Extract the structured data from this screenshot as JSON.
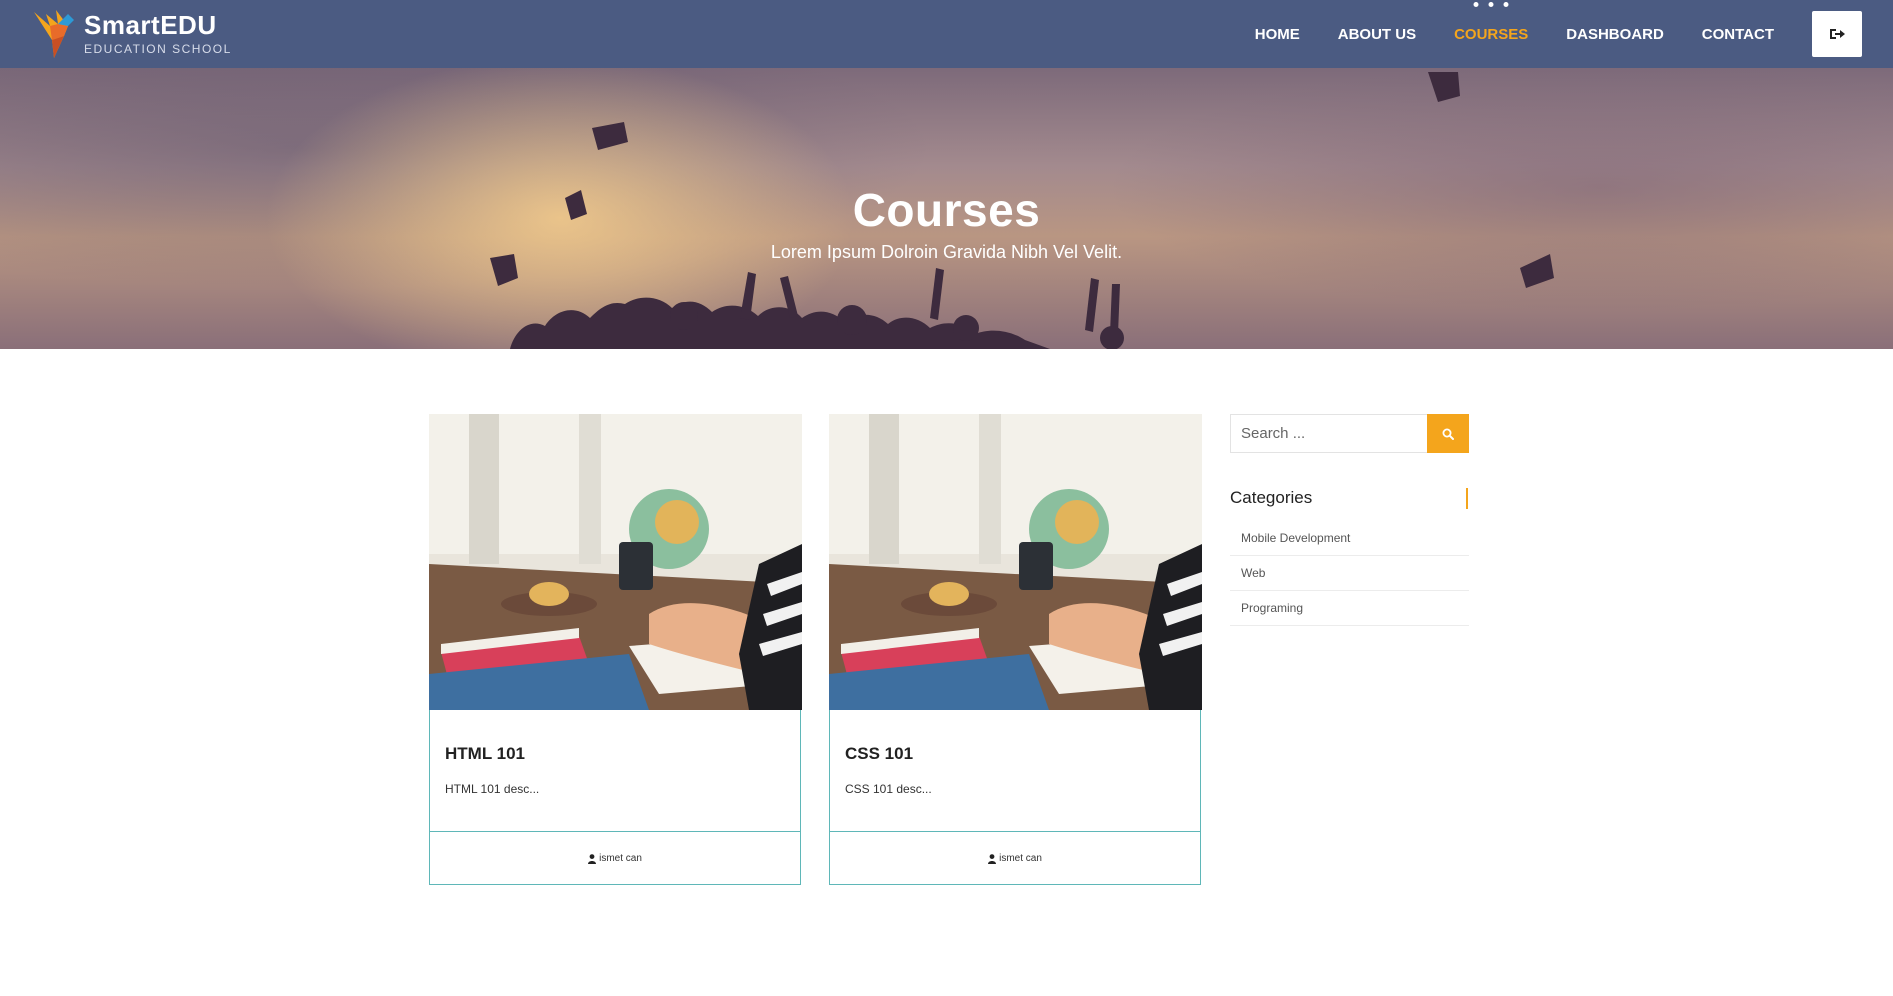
{
  "brand": {
    "name": "SmartEDU",
    "tagline": "EDUCATION SCHOOL"
  },
  "nav": {
    "items": [
      {
        "label": "HOME",
        "active": false
      },
      {
        "label": "ABOUT US",
        "active": false
      },
      {
        "label": "COURSES",
        "active": true
      },
      {
        "label": "DASHBOARD",
        "active": false
      },
      {
        "label": "CONTACT",
        "active": false
      }
    ],
    "logout_icon": "sign-out-icon"
  },
  "hero": {
    "title": "Courses",
    "subtitle": "Lorem Ipsum Dolroin Gravida Nibh Vel Velit."
  },
  "courses": [
    {
      "title": "HTML 101",
      "description": "HTML 101 desc...",
      "author": "ismet can"
    },
    {
      "title": "CSS 101",
      "description": "CSS 101 desc...",
      "author": "ismet can"
    }
  ],
  "sidebar": {
    "search": {
      "placeholder": "Search ...",
      "value": ""
    },
    "categories_title": "Categories",
    "categories": [
      "Mobile Development",
      "Web",
      "Programing"
    ]
  },
  "colors": {
    "header_bg": "#4b5b82",
    "accent": "#f4a51c",
    "card_border": "#5fb7b8"
  }
}
